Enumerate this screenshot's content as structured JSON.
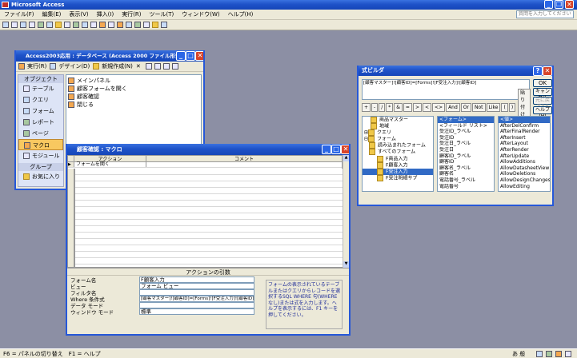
{
  "app": {
    "title": "Microsoft Access",
    "help_placeholder": "質問を入力してください"
  },
  "menu": [
    "ファイル(F)",
    "編集(E)",
    "表示(V)",
    "挿入(I)",
    "実行(R)",
    "ツール(T)",
    "ウィンドウ(W)",
    "ヘルプ(H)"
  ],
  "db_window": {
    "title": "Access2003応用 : データベース (Access 2000 ファイル形式)",
    "toolbar": {
      "run": "実行(R)",
      "design": "デザイン(D)",
      "new": "新規作成(N)",
      "delete": "✕"
    },
    "objects_header": "オブジェクト",
    "objects": [
      "テーブル",
      "クエリ",
      "フォーム",
      "レポート",
      "ページ",
      "マクロ",
      "モジュール"
    ],
    "group_header": "グループ",
    "groups": [
      "お気に入り"
    ],
    "items": [
      "メインパネル",
      "顧客フォームを開く",
      "顧客確認",
      "閉じる"
    ]
  },
  "macro_window": {
    "title": "顧客確認 : マクロ",
    "col_action": "アクション",
    "col_comment": "コメント",
    "first_action": "フォームを開く",
    "args_header": "アクションの引数",
    "args": [
      {
        "label": "フォーム名",
        "value": "F顧客入力"
      },
      {
        "label": "ビュー",
        "value": "フォーム ビュー"
      },
      {
        "label": "フィルタ名",
        "value": ""
      },
      {
        "label": "Where 条件式",
        "value": "[顧客マスター]![顧客ID]=[Forms]![F受注入力]![顧客ID]"
      },
      {
        "label": "データ モード",
        "value": ""
      },
      {
        "label": "ウィンドウ モード",
        "value": "標準"
      }
    ],
    "help": "フォームの表示されているテーブルまたはクエリからレコードを選択するSQL WHERE 句(WHERE なし)または式を入力します。ヘルプを表示するには、F1 キーを押してください。"
  },
  "expr_builder": {
    "title": "式ビルダ",
    "expression": "[顧客マスター]![顧客ID]=[Forms]![F受注入力]![顧客ID]",
    "ok": "OK",
    "cancel": "キャンセル",
    "undo": "元に戻す(U)",
    "help": "ヘルプ(H)",
    "paste": "貼り付け(P)",
    "operators": [
      "+",
      "-",
      "/",
      "*",
      "&",
      "=",
      ">",
      "<",
      "<>",
      "And",
      "Or",
      "Not",
      "Like",
      "(",
      ")"
    ],
    "tree": [
      "商品マスター",
      "地域",
      "クエリ",
      "フォーム",
      "読み込まれたフォーム",
      "すべてのフォーム",
      "F商品入力",
      "F顧客入力",
      "F受注入力",
      "F受注明細サブ"
    ],
    "fields": [
      "<フォーム>",
      "<フィールド リスト>",
      "受注ID_ラベル",
      "受注ID",
      "受注日_ラベル",
      "受注日",
      "顧客ID_ラベル",
      "顧客ID",
      "顧客名_ラベル",
      "顧客名",
      "電話番号_ラベル",
      "電話番号"
    ],
    "props": [
      "<値>",
      "AfterDelConfirm",
      "AfterFinalRender",
      "AfterInsert",
      "AfterLayout",
      "AfterRender",
      "AfterUpdate",
      "AllowAdditions",
      "AllowDatasheetView",
      "AllowDeletions",
      "AllowDesignChanges",
      "AllowEditing"
    ]
  },
  "status": {
    "text": "F6 = パネルの切り替え　F1 = ヘルプ",
    "ime": "あ 般"
  }
}
